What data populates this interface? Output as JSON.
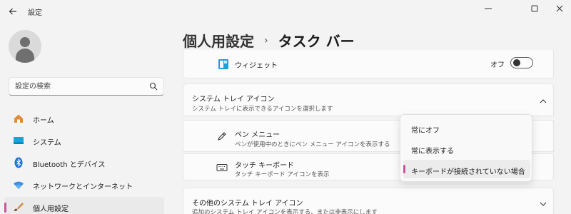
{
  "window": {
    "title": "設定",
    "controls": {
      "minimize": "minimize-icon",
      "maximize": "maximize-icon",
      "close": "close-icon"
    }
  },
  "sidebar": {
    "search_placeholder": "設定の検索",
    "items": [
      {
        "label": "ホーム",
        "icon": "home-icon"
      },
      {
        "label": "システム",
        "icon": "system-icon"
      },
      {
        "label": "Bluetooth とデバイス",
        "icon": "bluetooth-icon"
      },
      {
        "label": "ネットワークとインターネット",
        "icon": "wifi-icon"
      },
      {
        "label": "個人用設定",
        "icon": "personalization-icon",
        "active": true
      }
    ]
  },
  "header": {
    "breadcrumb_parent": "個人用設定",
    "breadcrumb_separator": "›",
    "breadcrumb_current": "タスク バー"
  },
  "widget_row": {
    "label": "ウィジェット",
    "toggle_label": "オフ",
    "toggle_on": false
  },
  "tray_section": {
    "title": "システム トレイ アイコン",
    "description": "システム トレイに表示できるアイコンを選択します",
    "expanded": true,
    "items": [
      {
        "title": "ペン メニュー",
        "description": "ペンが使用中のときにペン メニュー アイコンを表示する",
        "icon": "pen-icon"
      },
      {
        "title": "タッチ キーボード",
        "description": "タッチ キーボード アイコンを表示",
        "icon": "keyboard-icon"
      }
    ]
  },
  "dropdown": {
    "options": [
      "常にオフ",
      "常に表示する",
      "キーボードが接続されていない場合"
    ],
    "selected_index": 2
  },
  "other_section": {
    "title": "その他のシステム トレイ アイコン",
    "description": "追加のシステム トレイ アイコンを表示する、または非表示にします"
  },
  "colors": {
    "accent": "#c4569b",
    "background": "#f3f3f3",
    "card": "#fbfbfb"
  }
}
